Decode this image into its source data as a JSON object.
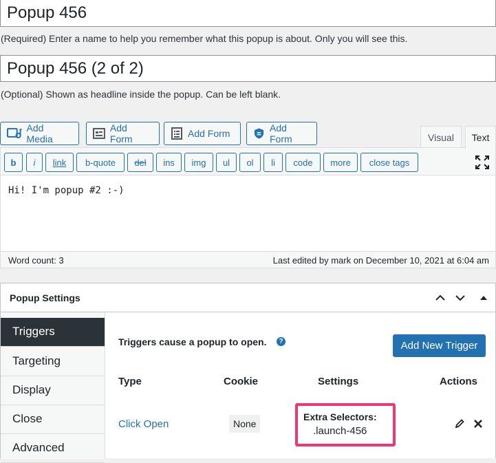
{
  "popup": {
    "name_value": "Popup 456",
    "name_help": "(Required) Enter a name to help you remember what this popup is about. Only you will see this.",
    "headline_value": "Popup 456 (2 of 2)",
    "headline_help": "(Optional) Shown as headline inside the popup. Can be left blank."
  },
  "media_buttons": [
    {
      "label": "Add Media",
      "icon": "media-icon"
    },
    {
      "label": "Add Form",
      "icon": "form-icon"
    },
    {
      "label": "Add Form",
      "icon": "form-list-icon"
    },
    {
      "label": "Add Form",
      "icon": "form-shield-icon"
    }
  ],
  "editor_tabs": {
    "visual": "Visual",
    "text": "Text"
  },
  "quicktags": [
    "b",
    "i",
    "link",
    "b-quote",
    "del",
    "ins",
    "img",
    "ul",
    "ol",
    "li",
    "code",
    "more",
    "close tags"
  ],
  "editor": {
    "content": "Hi! I'm popup #2 :-)",
    "word_count": "Word count: 3",
    "last_edited": "Last edited by mark on December 10, 2021 at 6:04 am"
  },
  "settings": {
    "title": "Popup Settings",
    "tabs": [
      "Triggers",
      "Targeting",
      "Display",
      "Close",
      "Advanced"
    ],
    "active_tab": "Triggers",
    "description": "Triggers cause a popup to open.",
    "help_glyph": "?",
    "add_button": "Add New Trigger",
    "columns": [
      "Type",
      "Cookie",
      "Settings",
      "Actions"
    ],
    "rows": [
      {
        "type": "Click Open",
        "cookie": "None",
        "settings_label": "Extra Selectors:",
        "settings_value": ".launch-456"
      }
    ]
  },
  "colors": {
    "accent": "#2271b1",
    "highlight": "#ef3773",
    "active_tab_bg": "#2c3338"
  }
}
